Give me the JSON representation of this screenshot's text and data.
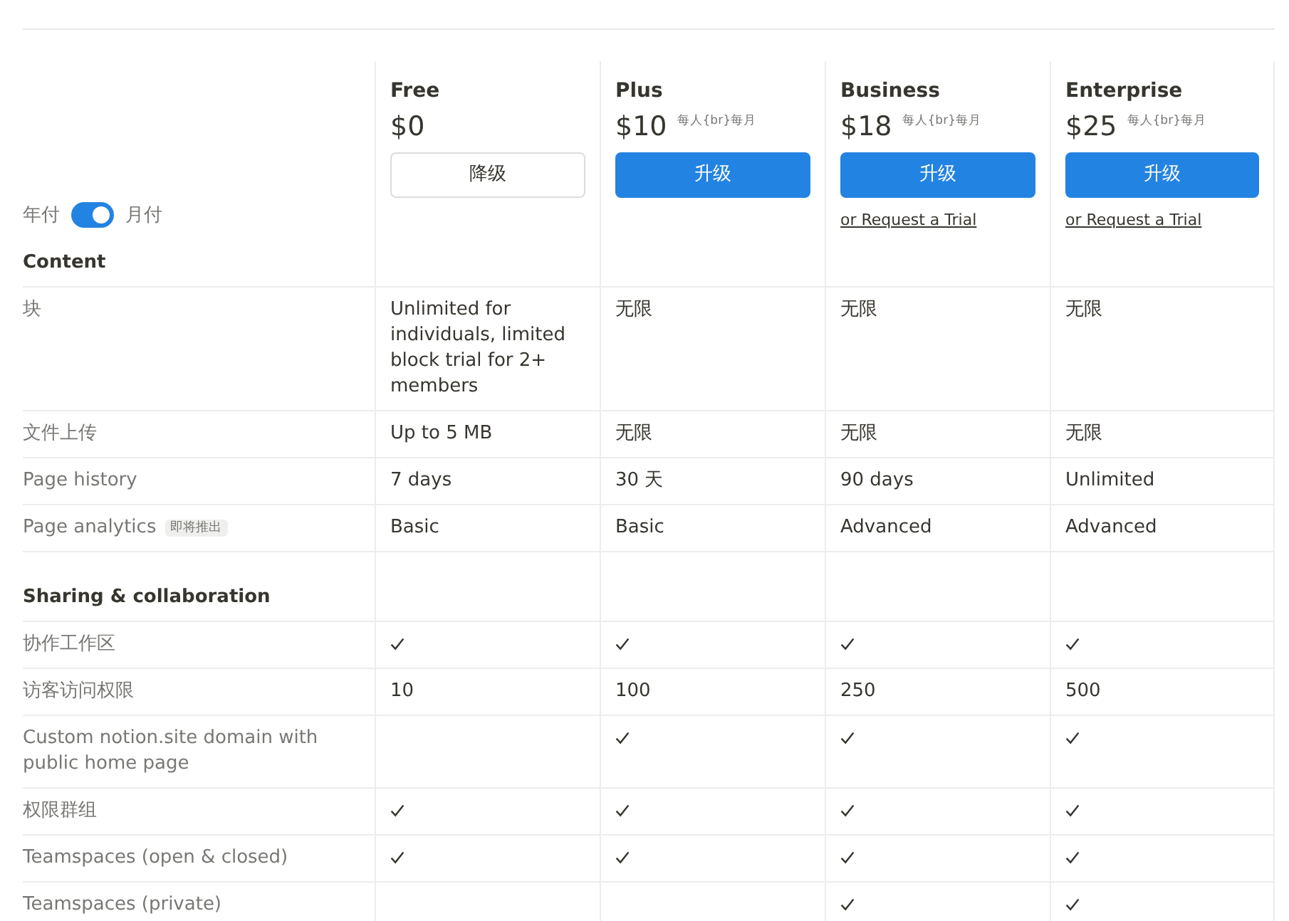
{
  "billing_toggle": {
    "left_label": "年付",
    "right_label": "月付",
    "on": true
  },
  "plans": [
    {
      "name": "Free",
      "price": "$0",
      "button": {
        "label": "降级",
        "kind": "outline"
      }
    },
    {
      "name": "Plus",
      "price": "$10",
      "per_unit": "每人{br}每月",
      "button": {
        "label": "升级",
        "kind": "primary"
      }
    },
    {
      "name": "Business",
      "price": "$18",
      "per_unit": "每人{br}每月",
      "button": {
        "label": "升级",
        "kind": "primary"
      },
      "trial_link": "or Request a Trial"
    },
    {
      "name": "Enterprise",
      "price": "$25",
      "per_unit": "每人{br}每月",
      "button": {
        "label": "升级",
        "kind": "primary"
      },
      "trial_link": "or Request a Trial"
    }
  ],
  "sections": [
    {
      "title": "Content",
      "rows": [
        {
          "label": "块",
          "cells": [
            {
              "kind": "text",
              "text": "Unlimited for individuals, limited block trial for 2+ members"
            },
            {
              "kind": "text",
              "text": "无限"
            },
            {
              "kind": "text",
              "text": "无限"
            },
            {
              "kind": "text",
              "text": "无限"
            }
          ]
        },
        {
          "label": "文件上传",
          "cells": [
            {
              "kind": "text",
              "text": "Up to 5 MB"
            },
            {
              "kind": "text",
              "text": "无限"
            },
            {
              "kind": "text",
              "text": "无限"
            },
            {
              "kind": "text",
              "text": "无限"
            }
          ]
        },
        {
          "label": "Page history",
          "cells": [
            {
              "kind": "text",
              "text": "7 days"
            },
            {
              "kind": "text",
              "text": "30 天"
            },
            {
              "kind": "text",
              "text": "90 days"
            },
            {
              "kind": "text",
              "text": "Unlimited"
            }
          ]
        },
        {
          "label": "Page analytics",
          "badge": "即将推出",
          "cells": [
            {
              "kind": "text",
              "text": "Basic"
            },
            {
              "kind": "text",
              "text": "Basic"
            },
            {
              "kind": "text",
              "text": "Advanced"
            },
            {
              "kind": "text",
              "text": "Advanced"
            }
          ]
        }
      ]
    },
    {
      "title": "Sharing & collaboration",
      "rows": [
        {
          "label": "协作工作区",
          "cells": [
            {
              "kind": "check"
            },
            {
              "kind": "check"
            },
            {
              "kind": "check"
            },
            {
              "kind": "check"
            }
          ]
        },
        {
          "label": "访客访问权限",
          "cells": [
            {
              "kind": "text",
              "text": "10"
            },
            {
              "kind": "text",
              "text": "100"
            },
            {
              "kind": "text",
              "text": "250"
            },
            {
              "kind": "text",
              "text": "500"
            }
          ]
        },
        {
          "label": "Custom notion.site domain with public home page",
          "cells": [
            {
              "kind": "empty"
            },
            {
              "kind": "check"
            },
            {
              "kind": "check"
            },
            {
              "kind": "check"
            }
          ]
        },
        {
          "label": "权限群组",
          "cells": [
            {
              "kind": "check"
            },
            {
              "kind": "check"
            },
            {
              "kind": "check"
            },
            {
              "kind": "check"
            }
          ]
        },
        {
          "label": "Teamspaces (open & closed)",
          "cells": [
            {
              "kind": "check"
            },
            {
              "kind": "check"
            },
            {
              "kind": "check"
            },
            {
              "kind": "check"
            }
          ]
        },
        {
          "label": "Teamspaces (private)",
          "cells": [
            {
              "kind": "empty"
            },
            {
              "kind": "empty"
            },
            {
              "kind": "check"
            },
            {
              "kind": "check"
            }
          ]
        }
      ]
    }
  ]
}
